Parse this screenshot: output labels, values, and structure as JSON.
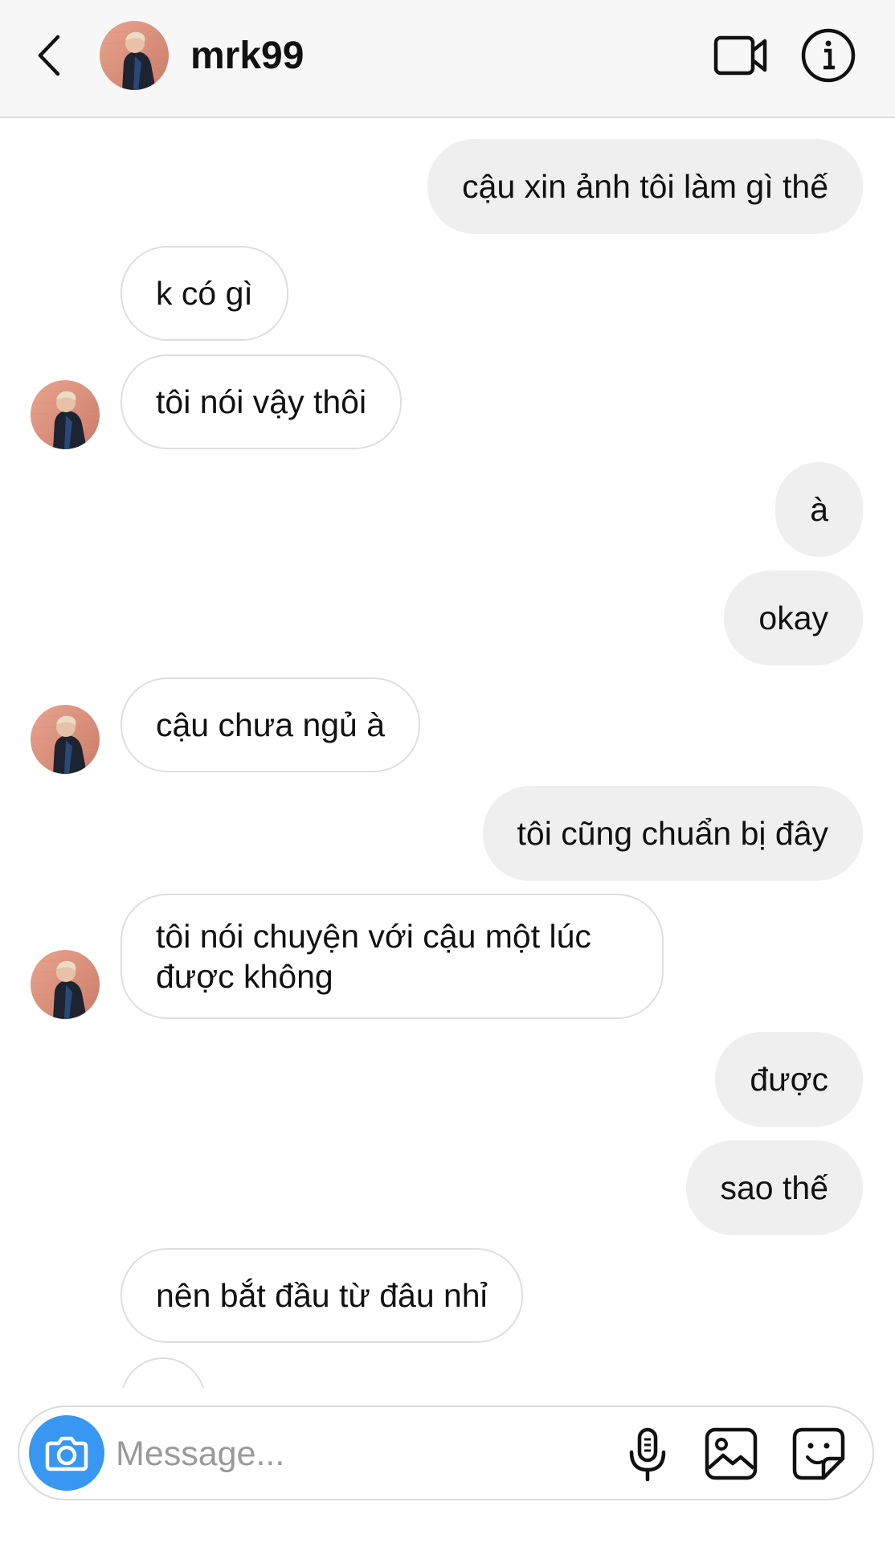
{
  "header": {
    "username": "mrk99",
    "icons": [
      "back-arrow-icon",
      "avatar",
      "video-call-icon",
      "info-icon"
    ]
  },
  "messages": [
    {
      "side": "out",
      "text": "cậu xin ảnh tôi làm gì thế"
    },
    {
      "side": "in",
      "text": "k có gì"
    },
    {
      "side": "in",
      "text": "tôi nói vậy thôi"
    },
    {
      "side": "out",
      "text": "à"
    },
    {
      "side": "out",
      "text": "okay"
    },
    {
      "side": "in",
      "text": "cậu chưa ngủ à"
    },
    {
      "side": "out",
      "text": "tôi cũng chuẩn bị đây"
    },
    {
      "side": "in",
      "text": "tôi nói chuyện với cậu một lúc được không"
    },
    {
      "side": "out",
      "text": "được"
    },
    {
      "side": "out",
      "text": "sao thế"
    },
    {
      "side": "in",
      "text": "nên bắt đầu từ đâu nhỉ"
    }
  ],
  "composer": {
    "placeholder": "Message...",
    "accent_color": "#3897f0",
    "icons": [
      "camera-icon",
      "microphone-icon",
      "gallery-icon",
      "sticker-icon"
    ]
  }
}
